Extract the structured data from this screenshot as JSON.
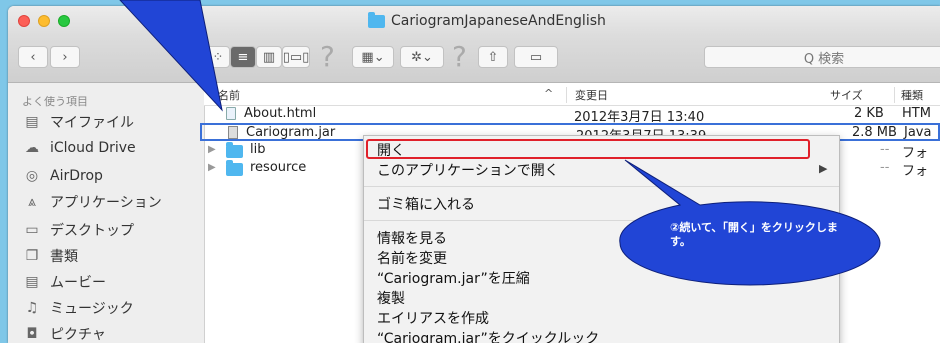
{
  "window": {
    "title": "CariogramJapaneseAndEnglish"
  },
  "toolbar": {
    "search_placeholder": "Q 検索",
    "back": "‹",
    "forward": "›"
  },
  "sidebar": {
    "section": "よく使う項目",
    "items": [
      {
        "label": "マイファイル",
        "icon": "all-files-icon"
      },
      {
        "label": "iCloud Drive",
        "icon": "cloud-icon"
      },
      {
        "label": "AirDrop",
        "icon": "airdrop-icon"
      },
      {
        "label": "アプリケーション",
        "icon": "applications-icon"
      },
      {
        "label": "デスクトップ",
        "icon": "desktop-icon"
      },
      {
        "label": "書類",
        "icon": "documents-icon"
      },
      {
        "label": "ムービー",
        "icon": "movies-icon"
      },
      {
        "label": "ミュージック",
        "icon": "music-icon"
      },
      {
        "label": "ピクチャ",
        "icon": "pictures-icon"
      }
    ]
  },
  "columns": {
    "name": "名前",
    "date": "変更日",
    "size": "サイズ",
    "kind": "種類"
  },
  "files": [
    {
      "name": "About.html",
      "date": "2012年3月7日 13:40",
      "size": "2 KB",
      "kind": "HTM"
    },
    {
      "name": "Cariogram.jar",
      "date": "2012年3月7日 13:39",
      "size": "2.8 MB",
      "kind": "Java"
    },
    {
      "name": "lib",
      "date": "",
      "size": "--",
      "kind": "フォ"
    },
    {
      "name": "resource",
      "date": "",
      "size": "--",
      "kind": "フォ"
    }
  ],
  "context_menu": {
    "open": "開く",
    "open_with": "このアプリケーションで開く",
    "trash": "ゴミ箱に入れる",
    "info": "情報を見る",
    "rename": "名前を変更",
    "compress": "“Cariogram.jar”を圧縮",
    "duplicate": "複製",
    "alias": "エイリアスを作成",
    "quicklook": "“Cariogram.jar”をクイックルック"
  },
  "callout": {
    "text": "②続いて、「開く」をクリックします。"
  },
  "colors": {
    "callout_fill": "#1f3fd6",
    "highlight": "#e0202a",
    "folder": "#4fb7ef",
    "desktop": "#7fc7e8"
  }
}
